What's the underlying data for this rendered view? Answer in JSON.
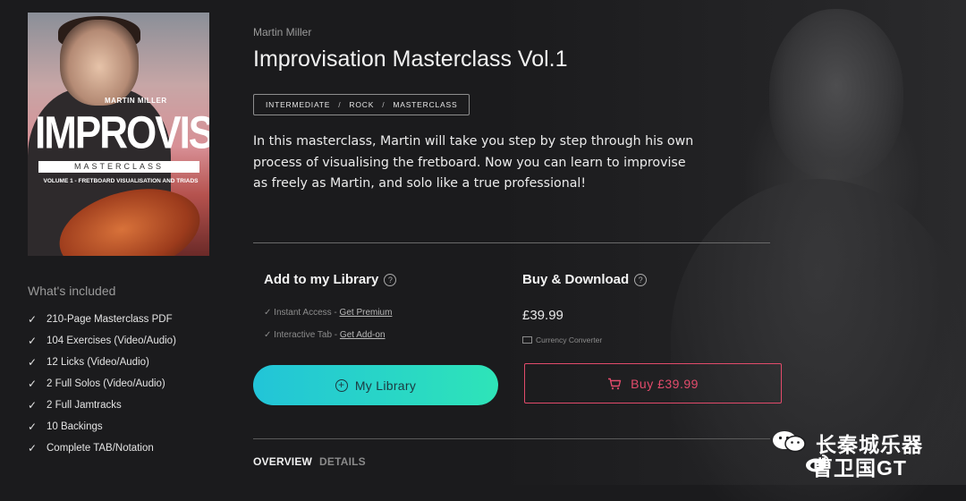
{
  "cover": {
    "artist": "MARTIN MILLER",
    "title": "IMPROVISATION",
    "subtitle": "MASTERCLASS",
    "volume": "VOLUME 1 - FRETBOARD VISUALISATION AND TRIADS"
  },
  "included": {
    "heading": "What's included",
    "items": [
      "210-Page Masterclass PDF",
      "104 Exercises (Video/Audio)",
      "12 Licks (Video/Audio)",
      "2 Full Solos (Video/Audio)",
      "2 Full Jamtracks",
      "10 Backings",
      "Complete TAB/Notation"
    ]
  },
  "product": {
    "artist": "Martin Miller",
    "title": "Improvisation Masterclass Vol.1",
    "tags": [
      "INTERMEDIATE",
      "ROCK",
      "MASTERCLASS"
    ],
    "description": "In this masterclass, Martin will take you step by step through his own process of visualising the fretboard. Now you can learn to improvise as freely as Martin, and solo like a true professional!"
  },
  "library": {
    "heading": "Add to my Library",
    "help_icon": "?",
    "feature1_text": "Instant Access - ",
    "feature1_link": "Get Premium",
    "feature2_text": "Interactive Tab - ",
    "feature2_link": "Get Add-on",
    "button_label": "My Library"
  },
  "buy": {
    "heading": "Buy & Download",
    "help_icon": "?",
    "price": "£39.99",
    "currency_converter": "Currency Converter",
    "button_label": "Buy £39.99"
  },
  "tabs": [
    "OVERVIEW",
    "DETAILS"
  ],
  "watermark": {
    "line1": "长秦城乐器",
    "line2": "曹卫国GT"
  },
  "colors": {
    "accent_teal": "#22c4d8",
    "accent_green": "#2ee4b8",
    "buy_red": "#e24b6b",
    "background": "#1b1b1d"
  }
}
